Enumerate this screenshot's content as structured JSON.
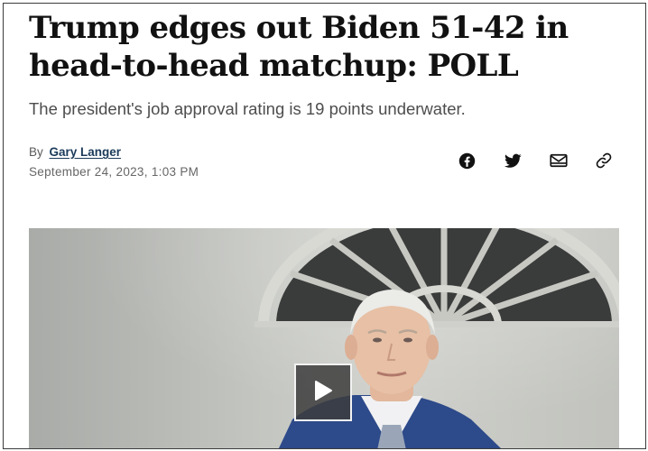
{
  "article": {
    "headline": "Trump edges out Biden 51-42 in head-to-head matchup: POLL",
    "subheadline": "The president's job approval rating is 19 points underwater.",
    "byline_prefix": "By",
    "author": "Gary Langer",
    "date": "September 24, 2023, 1:03 PM"
  },
  "share": {
    "icons": [
      "facebook-icon",
      "twitter-icon",
      "email-icon",
      "link-icon"
    ]
  },
  "media": {
    "type": "video",
    "play_icon": "play-icon"
  },
  "colors": {
    "author_link": "#1b3a5a",
    "subhead_text": "#4d4d4d",
    "suit": "#2d4a8a"
  }
}
